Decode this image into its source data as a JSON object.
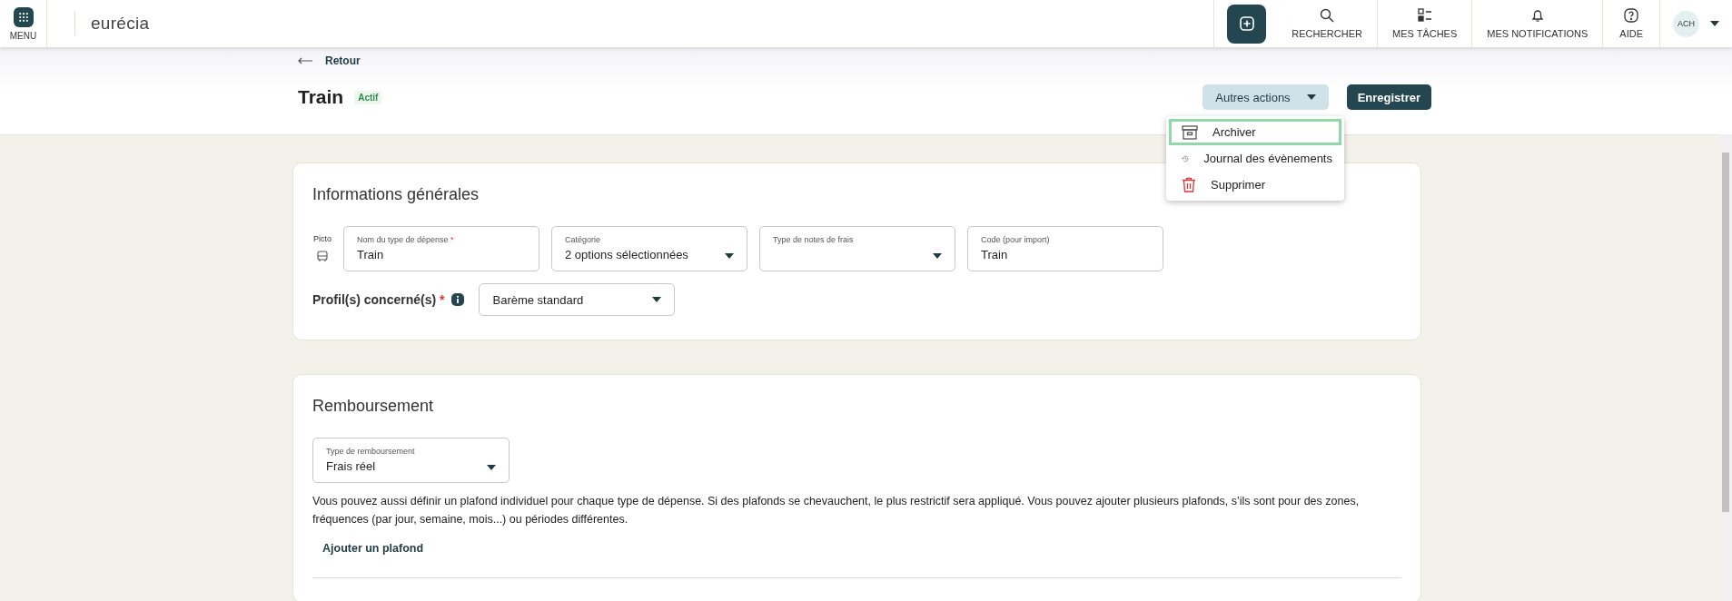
{
  "header": {
    "menu_label": "MENU",
    "logo": "eurécia",
    "nav": [
      {
        "kind": "search",
        "label": "RECHERCHER"
      },
      {
        "kind": "tasks",
        "label": "MES TÂCHES"
      },
      {
        "kind": "bell",
        "label": "MES NOTIFICATIONS"
      },
      {
        "kind": "help",
        "label": "AIDE"
      }
    ],
    "avatar": "ACH"
  },
  "back_link": "Retour",
  "title": "Train",
  "status": "Actif",
  "actions": {
    "more_label": "Autres actions",
    "save_label": "Enregistrer",
    "menu": [
      {
        "kind": "archive",
        "label": "Archiver",
        "selected": true
      },
      {
        "kind": "history",
        "label": "Journal des évènements",
        "selected": false
      },
      {
        "kind": "delete",
        "label": "Supprimer",
        "selected": false
      }
    ]
  },
  "general": {
    "title": "Informations générales",
    "picto_label": "Picto",
    "fields": [
      {
        "kind": "text",
        "label": "Nom du type de dépense",
        "required_mark": "*",
        "value": "Train"
      },
      {
        "kind": "select",
        "label": "Catégorie",
        "value": "2 options sélectionnées"
      },
      {
        "kind": "select",
        "label": "Type de notes de frais"
      },
      {
        "kind": "text",
        "label": "Code (pour import)",
        "value": "Train"
      }
    ],
    "profiles_label": "Profil(s) concerné(s)",
    "profiles_required_mark": "*",
    "profiles_value": "Barème standard"
  },
  "reimbursement": {
    "title": "Remboursement",
    "type_label": "Type de remboursement",
    "type_value": "Frais réel",
    "description": "Vous pouvez aussi définir un plafond individuel pour chaque type de dépense. Si des plafonds se chevauchent, le plus restrictif sera appliqué. Vous pouvez ajouter plusieurs plafonds, s’ils sont pour des zones, fréquences (par jour, semaine, mois...) ou périodes différentes.",
    "add_label": "Ajouter un plafond"
  }
}
